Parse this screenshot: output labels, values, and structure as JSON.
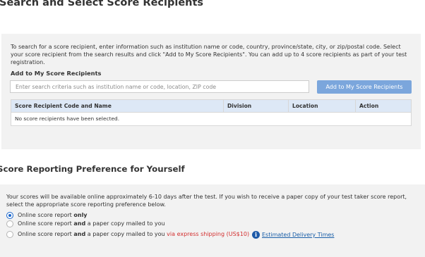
{
  "page_title": "Search and Select Score Recipients",
  "recipients": {
    "intro": "To search for a score recipient, enter information such as institution name or code, country, province/state, city, or zip/postal code. Select your score recipient from the search results and click \"Add to My Score Recipients\". You can add up to 4 score recipients as part of your test registration.",
    "add_label": "Add to My Score Recipients",
    "search_placeholder": "Enter search criteria such as institution name or code, location, ZIP code",
    "search_value": "",
    "add_button": "Add to My Score Recipients",
    "table": {
      "columns": [
        "Score Recipient Code and Name",
        "Division",
        "Location",
        "Action"
      ],
      "empty_message": "No score recipients have been selected."
    }
  },
  "preference": {
    "heading": "Score Reporting Preference for Yourself",
    "intro": "Your scores will be available online approximately 6-10 days after the test. If you wish to receive a paper copy of your test taker score report, select the appropriate score reporting preference below.",
    "options": [
      {
        "prefix": "Online score report",
        "bold": "only",
        "suffix": "",
        "extra": "",
        "selected": true
      },
      {
        "prefix": "Online score report",
        "bold": "and",
        "suffix": "a paper copy mailed to you",
        "extra": "",
        "selected": false
      },
      {
        "prefix": "Online score report",
        "bold": "and",
        "suffix": "a paper copy mailed to you",
        "extra": "via express shipping (US$10)",
        "selected": false
      }
    ],
    "info_icon": "info-icon",
    "delivery_link": "Estimated Delivery Times"
  },
  "colors": {
    "panel_background": "#f2f2f2",
    "button_blue": "#7ba6dc",
    "table_header": "#dde8f6",
    "link_blue": "#1a5fa8",
    "express_red": "#d32f2f",
    "radio_selected": "#1a66cc"
  }
}
